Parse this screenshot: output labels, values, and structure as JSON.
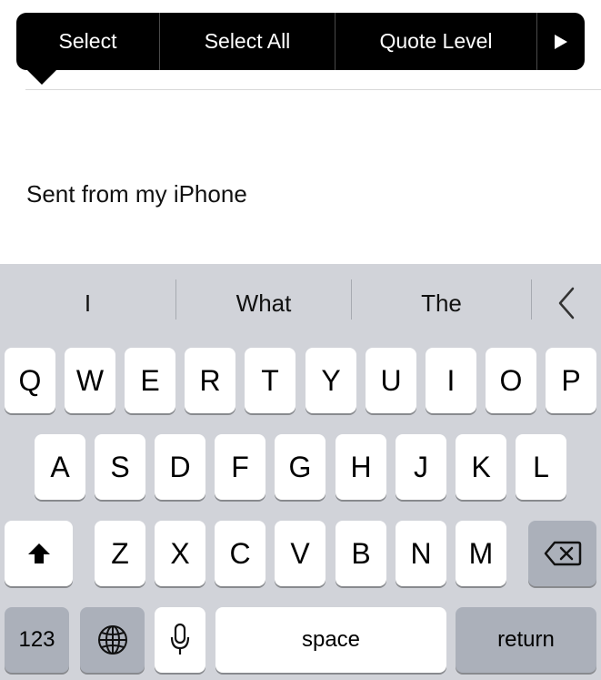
{
  "edit_menu": {
    "items": [
      "Select",
      "Select All",
      "Quote Level"
    ],
    "more_icon": "right-triangle-icon"
  },
  "compose": {
    "signature": "Sent from my iPhone"
  },
  "keyboard": {
    "suggestions": [
      "I",
      "What",
      "The"
    ],
    "collapse_icon": "chevron-left-icon",
    "row1": [
      "Q",
      "W",
      "E",
      "R",
      "T",
      "Y",
      "U",
      "I",
      "O",
      "P"
    ],
    "row2": [
      "A",
      "S",
      "D",
      "F",
      "G",
      "H",
      "J",
      "K",
      "L"
    ],
    "row3": [
      "Z",
      "X",
      "C",
      "V",
      "B",
      "N",
      "M"
    ],
    "shift_icon": "shift-arrow-icon",
    "delete_icon": "delete-backspace-icon",
    "numbers_label": "123",
    "globe_icon": "globe-icon",
    "mic_icon": "microphone-icon",
    "space_label": "space",
    "return_label": "return"
  }
}
